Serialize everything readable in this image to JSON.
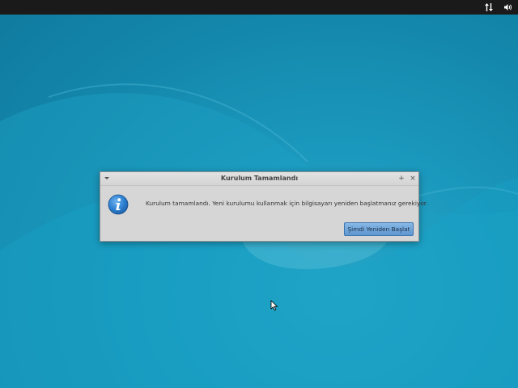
{
  "topbar": {
    "network_icon": "network-transfer-icon",
    "volume_icon": "volume-icon"
  },
  "dialog": {
    "title": "Kurulum Tamamlandı",
    "menu_icon": "chevron-down-icon",
    "pin_label": "+",
    "close_label": "×",
    "icon": "info-icon",
    "message": "Kurulum tamamlandı. Yeni kurulumu kullanmak için bilgisayarı yeniden başlatmanız gerekiyor.",
    "restart_label": "Şimdi Yeniden Başlat"
  },
  "colors": {
    "desktop": "#1b98bd",
    "topbar": "#1a1a1a",
    "dialog": "#d6d6d6",
    "button": "#6fa5db"
  }
}
